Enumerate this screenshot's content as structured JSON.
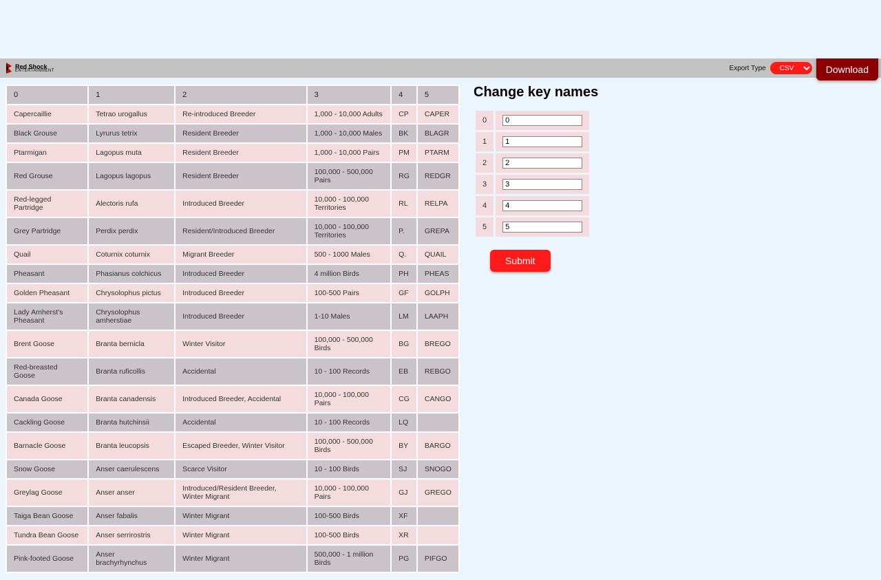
{
  "brand": {
    "name": "Red Shock",
    "sub": "ENTERTAINMENT"
  },
  "toolbar": {
    "export_label": "Export Type",
    "export_value": "CSV",
    "download_label": "Download"
  },
  "table": {
    "headers": [
      "0",
      "1",
      "2",
      "3",
      "4",
      "5"
    ],
    "rows": [
      [
        "Capercaillie",
        "Tetrao urogallus",
        "Re-introduced Breeder",
        "1,000 - 10,000 Adults",
        "CP",
        "CAPER"
      ],
      [
        "Black Grouse",
        "Lyrurus tetrix",
        "Resident Breeder",
        "1,000 - 10,000 Males",
        "BK",
        "BLAGR"
      ],
      [
        "Ptarmigan",
        "Lagopus muta",
        "Resident Breeder",
        "1,000 - 10,000 Pairs",
        "PM",
        "PTARM"
      ],
      [
        "Red Grouse",
        "Lagopus lagopus",
        "Resident Breeder",
        "100,000 - 500,000 Pairs",
        "RG",
        "REDGR"
      ],
      [
        "Red-legged Partridge",
        "Alectoris rufa",
        "Introduced Breeder",
        "10,000 - 100,000 Territories",
        "RL",
        "RELPA"
      ],
      [
        "Grey Partridge",
        "Perdix perdix",
        "Resident/Introduced Breeder",
        "10,000 - 100,000 Territories",
        "P.",
        "GREPA"
      ],
      [
        "Quail",
        "Coturnix coturnix",
        "Migrant Breeder",
        "500 - 1000 Males",
        "Q.",
        "QUAIL"
      ],
      [
        "Pheasant",
        "Phasianus colchicus",
        "Introduced Breeder",
        "4 million Birds",
        "PH",
        "PHEAS"
      ],
      [
        "Golden Pheasant",
        "Chrysolophus pictus",
        "Introduced Breeder",
        "100-500 Pairs",
        "GF",
        "GOLPH"
      ],
      [
        "Lady Amherst's Pheasant",
        "Chrysolophus amherstiae",
        "Introduced Breeder",
        "1-10 Males",
        "LM",
        "LAAPH"
      ],
      [
        "Brent Goose",
        "Branta bernicla",
        "Winter Visitor",
        "100,000 - 500,000 Birds",
        "BG",
        "BREGO"
      ],
      [
        "Red-breasted Goose",
        "Branta ruficollis",
        "Accidental",
        "10 - 100 Records",
        "EB",
        "REBGO"
      ],
      [
        "Canada Goose",
        "Branta canadensis",
        "Introduced Breeder, Accidental",
        "10,000 - 100,000 Pairs",
        "CG",
        "CANGO"
      ],
      [
        "Cackling Goose",
        "Branta hutchinsii",
        "Accidental",
        "10 - 100 Records",
        "LQ",
        ""
      ],
      [
        "Barnacle Goose",
        "Branta leucopsis",
        "Escaped Breeder, Winter Visitor",
        "100,000 - 500,000 Birds",
        "BY",
        "BARGO"
      ],
      [
        "Snow Goose",
        "Anser caerulescens",
        "Scarce Visitor",
        "10 - 100 Birds",
        "SJ",
        "SNOGO"
      ],
      [
        "Greylag Goose",
        "Anser anser",
        "Introduced/Resident Breeder, Winter Migrant",
        "10,000 - 100,000 Pairs",
        "GJ",
        "GREGO"
      ],
      [
        "Taiga Bean Goose",
        "Anser fabalis",
        "Winter Migrant",
        "100-500 Birds",
        "XF",
        ""
      ],
      [
        "Tundra Bean Goose",
        "Anser serrirostris",
        "Winter Migrant",
        "100-500 Birds",
        "XR",
        ""
      ],
      [
        "Pink-footed Goose",
        "Anser brachyrhynchus",
        "Winter Migrant",
        "500,000 - 1 million Birds",
        "PG",
        "PIFGO"
      ]
    ]
  },
  "change": {
    "title": "Change key names",
    "keys": [
      "0",
      "1",
      "2",
      "3",
      "4",
      "5"
    ],
    "submit_label": "Submit"
  }
}
